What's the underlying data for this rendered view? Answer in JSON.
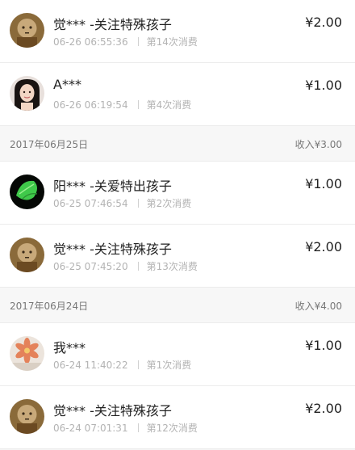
{
  "colors": {
    "primary_text": "#222222",
    "secondary_text": "#b3b3b3",
    "header_bg": "#f7f7f7",
    "divider": "#ececec"
  },
  "rows_top": [
    {
      "avatar_icon": "monk-avatar-icon",
      "name": "觉*** -关注特殊孩子",
      "time": "06-26 06:55:36",
      "count": "第14次消费",
      "amount": "¥2.00"
    },
    {
      "avatar_icon": "girl-avatar-icon",
      "name": "A***",
      "time": "06-26 06:19:54",
      "count": "第4次消费",
      "amount": "¥1.00"
    }
  ],
  "day1": {
    "date": "2017年06月25日",
    "total": "收入¥3.00"
  },
  "rows_day1": [
    {
      "avatar_icon": "green-leaf-avatar-icon",
      "name": "阳*** -关爱特出孩子",
      "time": "06-25 07:46:54",
      "count": "第2次消费",
      "amount": "¥1.00"
    },
    {
      "avatar_icon": "monk-avatar-icon",
      "name": "觉*** -关注特殊孩子",
      "time": "06-25 07:45:20",
      "count": "第13次消费",
      "amount": "¥2.00"
    }
  ],
  "day2": {
    "date": "2017年06月24日",
    "total": "收入¥4.00"
  },
  "rows_day2": [
    {
      "avatar_icon": "flower-avatar-icon",
      "name": "我***",
      "time": "06-24 11:40:22",
      "count": "第1次消费",
      "amount": "¥1.00"
    },
    {
      "avatar_icon": "monk-avatar-icon",
      "name": "觉*** -关注特殊孩子",
      "time": "06-24 07:01:31",
      "count": "第12次消费",
      "amount": "¥2.00"
    }
  ]
}
